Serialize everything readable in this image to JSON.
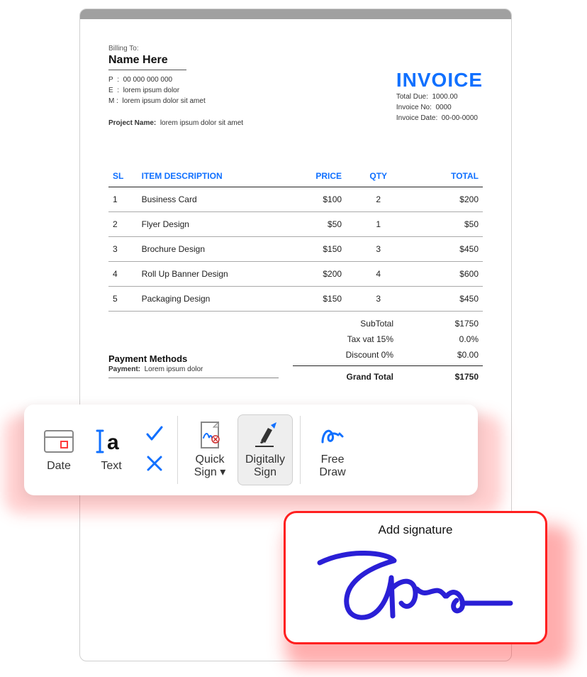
{
  "billing": {
    "heading": "Billing To:",
    "name": "Name Here",
    "phone_label": "P",
    "phone": "00 000 000 000",
    "email_label": "E",
    "email": "lorem ipsum dolor",
    "mail_label": "M",
    "mail": "lorem ipsum dolor sit amet",
    "project_label": "Project Name:",
    "project": "lorem ipsum dolor sit amet"
  },
  "invoice": {
    "title": "INVOICE",
    "total_due_label": "Total Due:",
    "total_due": "1000.00",
    "no_label": "Invoice No:",
    "no": "0000",
    "date_label": "Invoice Date:",
    "date": "00-00-0000"
  },
  "table": {
    "headers": {
      "sl": "SL",
      "desc": "ITEM DESCRIPTION",
      "price": "PRICE",
      "qty": "QTY",
      "total": "TOTAL"
    },
    "rows": [
      {
        "sl": "1",
        "desc": "Business Card",
        "price": "$100",
        "qty": "2",
        "total": "$200"
      },
      {
        "sl": "2",
        "desc": "Flyer Design",
        "price": "$50",
        "qty": "1",
        "total": "$50"
      },
      {
        "sl": "3",
        "desc": "Brochure Design",
        "price": "$150",
        "qty": "3",
        "total": "$450"
      },
      {
        "sl": "4",
        "desc": "Roll Up Banner Design",
        "price": "$200",
        "qty": "4",
        "total": "$600"
      },
      {
        "sl": "5",
        "desc": "Packaging  Design",
        "price": "$150",
        "qty": "3",
        "total": "$450"
      }
    ]
  },
  "summary": {
    "subtotal_label": "SubTotal",
    "subtotal": "$1750",
    "tax_label": "Tax vat 15%",
    "tax": "0.0%",
    "discount_label": "Discount 0%",
    "discount": "$0.00",
    "grand_label": "Grand Total",
    "grand": "$1750"
  },
  "payment": {
    "heading": "Payment Methods",
    "line_label": "Payment:",
    "line": "Lorem ipsum dolor"
  },
  "toolbar": {
    "date": "Date",
    "text": "Text",
    "quick_sign": "Quick\nSign ▾",
    "digitally_sign": "Digitally\nSign",
    "free_draw": "Free\nDraw"
  },
  "signature": {
    "title": "Add signature"
  },
  "colors": {
    "accent": "#1070ff",
    "danger": "#ff1f1f",
    "ink": "#2a1fd6"
  }
}
